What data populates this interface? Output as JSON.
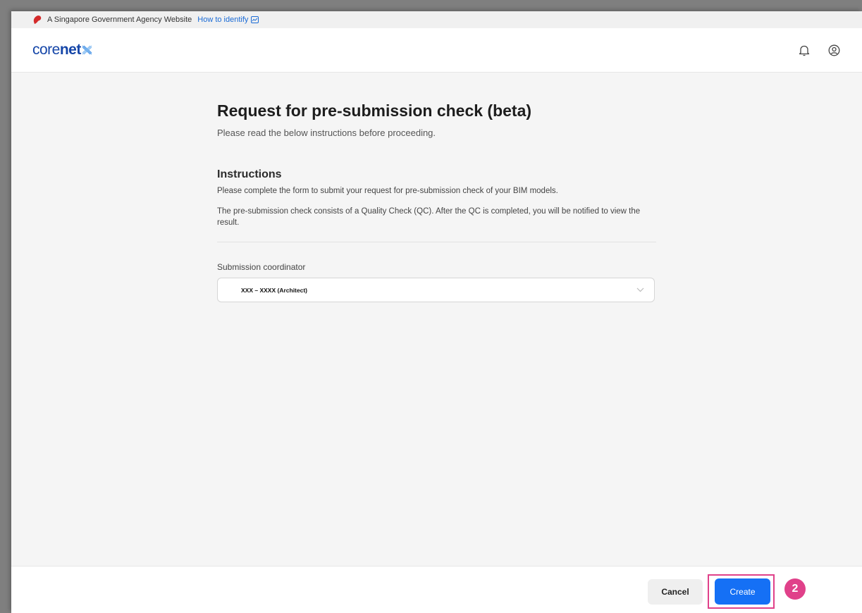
{
  "masthead": {
    "text": "A Singapore Government Agency Website",
    "link": "How to identify"
  },
  "header": {
    "logo_core": "core",
    "logo_net": "net"
  },
  "icons": {
    "bell": "bell-icon",
    "user": "user-circle-icon",
    "chevron": "chevron-down-icon"
  },
  "page": {
    "title": "Request for pre-submission check (beta)",
    "subtitle": "Please read the below instructions before proceeding."
  },
  "instructions": {
    "heading": "Instructions",
    "para1": "Please complete the form to submit your request for pre-submission check of your BIM models.",
    "para2": "The pre-submission check consists of a Quality Check (QC). After the QC is completed, you will be notified to view the result."
  },
  "form": {
    "coordinator_label": "Submission coordinator",
    "coordinator_value": "XXX – XXXX (Architect)"
  },
  "footer": {
    "cancel_label": "Cancel",
    "create_label": "Create",
    "step_number": "2"
  },
  "colors": {
    "brand": "#1546a8",
    "primary": "#1570f5",
    "highlight": "#e0418a"
  }
}
